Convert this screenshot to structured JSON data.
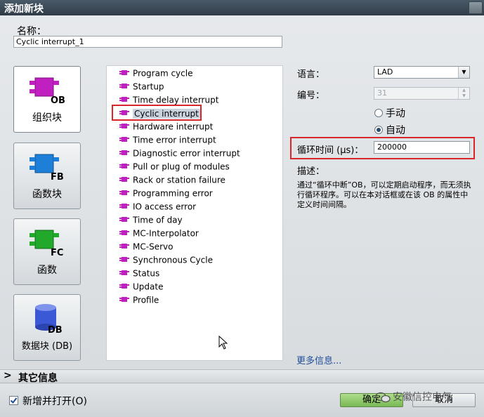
{
  "window": {
    "title": "添加新块"
  },
  "name": {
    "label": "名称：",
    "value": "Cyclic interrupt_1"
  },
  "categories": [
    {
      "label": "组织块",
      "badge": "OB",
      "color": "#c020c0",
      "active": true
    },
    {
      "label": "函数块",
      "badge": "FB",
      "color": "#1e7fd8",
      "active": false
    },
    {
      "label": "函数",
      "badge": "FC",
      "color": "#22a82a",
      "active": false
    },
    {
      "label": "数据块 (DB)",
      "badge": "DB",
      "color": "#3b59d6",
      "active": false
    }
  ],
  "ob_list": [
    "Program cycle",
    "Startup",
    "Time delay interrupt",
    "Cyclic interrupt",
    "Hardware interrupt",
    "Time error interrupt",
    "Diagnostic error interrupt",
    "Pull or plug of modules",
    "Rack or station failure",
    "Programming error",
    "IO access error",
    "Time of day",
    "MC-Interpolator",
    "MC-Servo",
    "Synchronous Cycle",
    "Status",
    "Update",
    "Profile"
  ],
  "selected_item": "Cyclic interrupt",
  "language": {
    "label": "语言：",
    "value": "LAD"
  },
  "number": {
    "label": "编号：",
    "value": "31"
  },
  "mode": {
    "manual": "手动",
    "auto": "自动",
    "selected": "auto"
  },
  "cycle_time": {
    "label": "循环时间 (µs)：",
    "value": "200000"
  },
  "description": {
    "label": "描述：",
    "text": "通过“循环中断”OB，可以定期启动程序，而无须执行循环程序。可以在本对话框或在该 OB 的属性中定义时间间隔。"
  },
  "more_info": "更多信息...",
  "other_info": "其它信息",
  "add_and_open": {
    "label": "新增并打开(O)",
    "checked": true
  },
  "buttons": {
    "ok": "确定",
    "cancel": "取消"
  },
  "watermark": "安徽信控电气",
  "colors": {
    "highlight_box": "#d8262a",
    "ok_button": "#8cc866",
    "link": "#1f4e9c"
  }
}
